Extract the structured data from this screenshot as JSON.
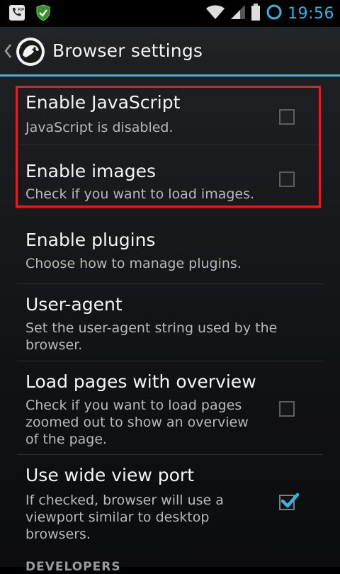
{
  "status_bar": {
    "time": "19:56",
    "colors": {
      "accent": "#33b5e5"
    }
  },
  "action_bar": {
    "title": "Browser settings"
  },
  "prefs": [
    {
      "title": "Enable JavaScript",
      "summary": "JavaScript is disabled.",
      "checked": false
    },
    {
      "title": "Enable images",
      "summary": "Check if you want to load images.",
      "checked": false
    },
    {
      "title": "Enable plugins",
      "summary": "Choose how to manage plugins."
    },
    {
      "title": "User-agent",
      "summary": "Set the user-agent string used by the browser."
    },
    {
      "title": "Load pages with overview",
      "summary": "Check if you want to load pages zoomed out to show an overview of the page.",
      "checked": false
    },
    {
      "title": "Use wide view port",
      "summary": "If checked, browser will use a viewport similar to desktop browsers.",
      "checked": true
    }
  ],
  "section_header": "DEVELOPERS",
  "colors": {
    "highlight": "#e51c23",
    "divider": "#33b5e5"
  }
}
